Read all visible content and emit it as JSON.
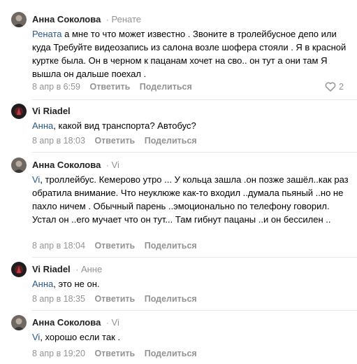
{
  "comments": [
    {
      "author": "Анна Соколова",
      "reply_to": "Ренате",
      "mention": "Рената",
      "text": " а мне то что может известно . Звоните в тролейбусное депо или куда Требуйте видеозапись из салона возле шофера стояли . Я в красной куртке была. Он в черном к пацанам хочет на сво.. он тут а они там Я вышла он дальше поехал .",
      "date": "8 апр в 6:59",
      "likes": "2"
    },
    {
      "author": "Vi Riadel",
      "reply_to": "",
      "mention": "Анна",
      "text": ", какой вид транспорта? Автобус?",
      "date": "8 апр в 18:03",
      "likes": ""
    },
    {
      "author": "Анна Соколова",
      "reply_to": "Vi",
      "mention": "Vi",
      "text": ", троллейбус. Кемерово утро ... У кольца зашла .он позже зашёл..как раз обратила внимание. Что неуклюже как-то входил ..думала пьяный ..но не пахло ничем . Обычный парень ..эмоционально по телефону говорил. Устал он ..его мучает что он тут... Там гибнут пацаны ..и он бессилен ..",
      "date": "8 апр в 18:04",
      "likes": ""
    },
    {
      "author": "Vi Riadel",
      "reply_to": "Анне",
      "mention": "Анна",
      "text": ", это не он.",
      "date": "8 апр в 18:35",
      "likes": ""
    },
    {
      "author": "Анна Соколова",
      "reply_to": "Vi",
      "mention": "Vi",
      "text": ", хорошо если так .",
      "date": "8 апр в 19:20",
      "likes": ""
    }
  ],
  "labels": {
    "reply": "Ответить",
    "share": "Поделиться"
  },
  "icons": {
    "reply_arrow": "reply-arrow-icon",
    "like": "heart-icon"
  },
  "colors": {
    "link": "#2a5885",
    "muted": "#939393",
    "separator": "#e7e8ec"
  }
}
